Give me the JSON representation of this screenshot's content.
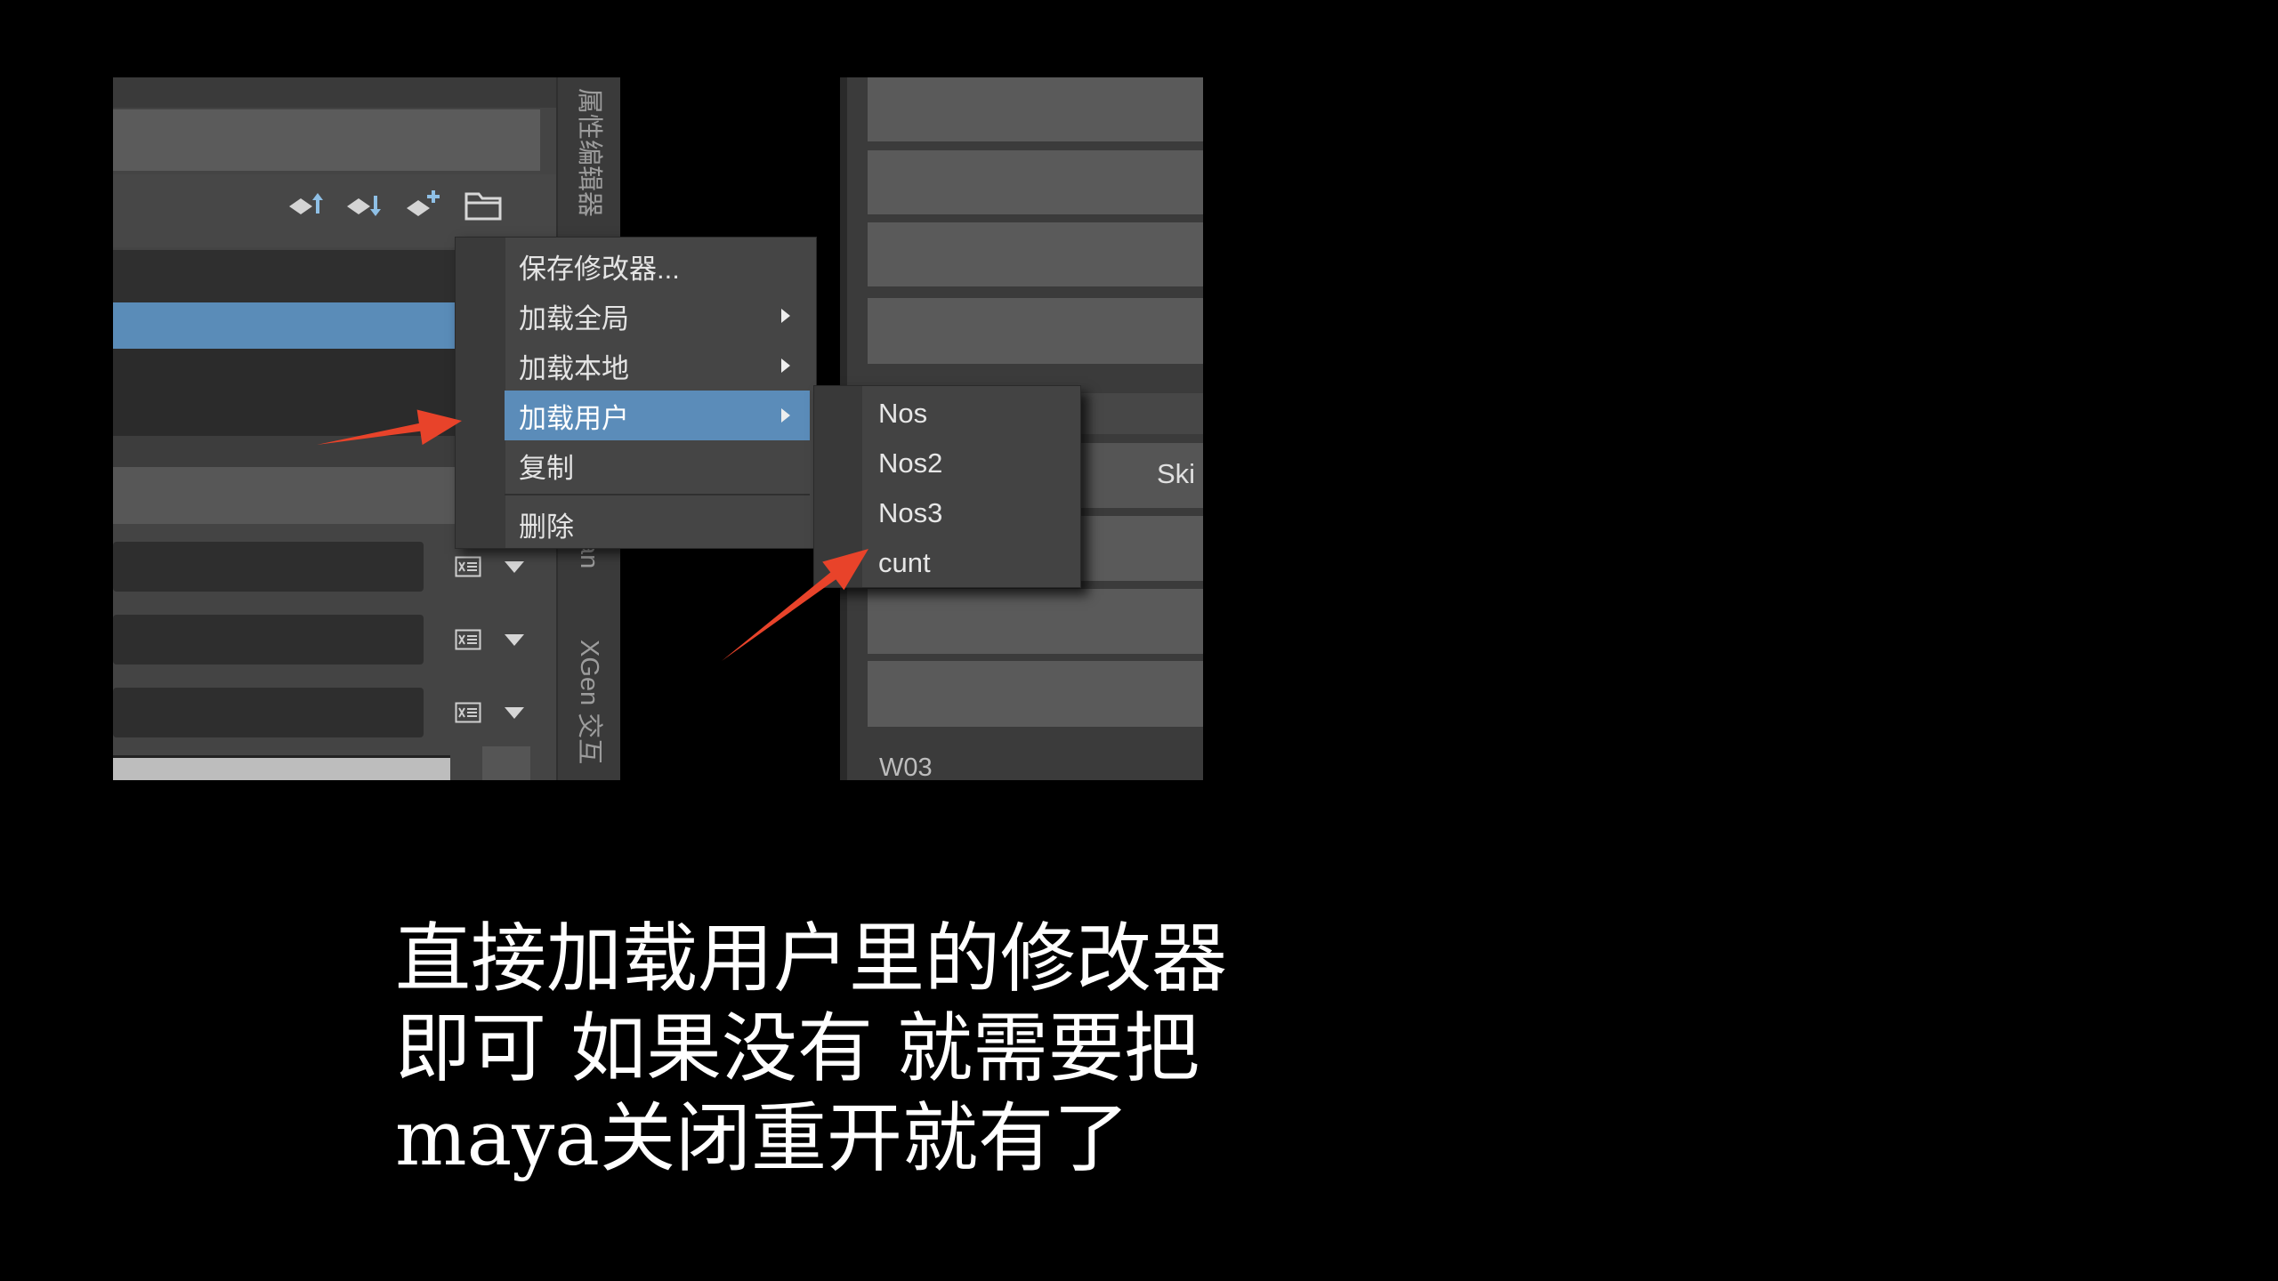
{
  "left_panel": {
    "tab_labels": [
      "属性编辑器",
      "an",
      "XGen 交互"
    ],
    "toolbar_icons": [
      "load-preset-up-icon",
      "load-preset-down-icon",
      "add-preset-icon",
      "folder-icon"
    ],
    "field_row_icons": [
      "channel-box-icon",
      "dropdown-arrow-icon"
    ]
  },
  "context_menu": {
    "items": [
      {
        "label": "保存修改器...",
        "has_submenu": false
      },
      {
        "label": "加载全局",
        "has_submenu": true
      },
      {
        "label": "加载本地",
        "has_submenu": true
      },
      {
        "label": "加载用户",
        "has_submenu": true,
        "highlighted": true
      },
      {
        "label": "复制",
        "has_submenu": false
      },
      {
        "label": "删除",
        "has_submenu": false
      }
    ]
  },
  "submenu": {
    "items": [
      "Nos",
      "Nos2",
      "Nos3",
      "cunt"
    ]
  },
  "right_panel": {
    "field_label": "Ski",
    "footer_label": "W03"
  },
  "caption": {
    "lines": [
      "直接加载用户里的修改器",
      "即可 如果没有 就需要把",
      "maya关闭重开就有了"
    ]
  },
  "colors": {
    "menu_highlight": "#5b8cb9",
    "selection_bar": "#5a8cb8",
    "annotation_arrow": "#e8432a",
    "caption_text": "#ffffff",
    "background": "#000000"
  }
}
